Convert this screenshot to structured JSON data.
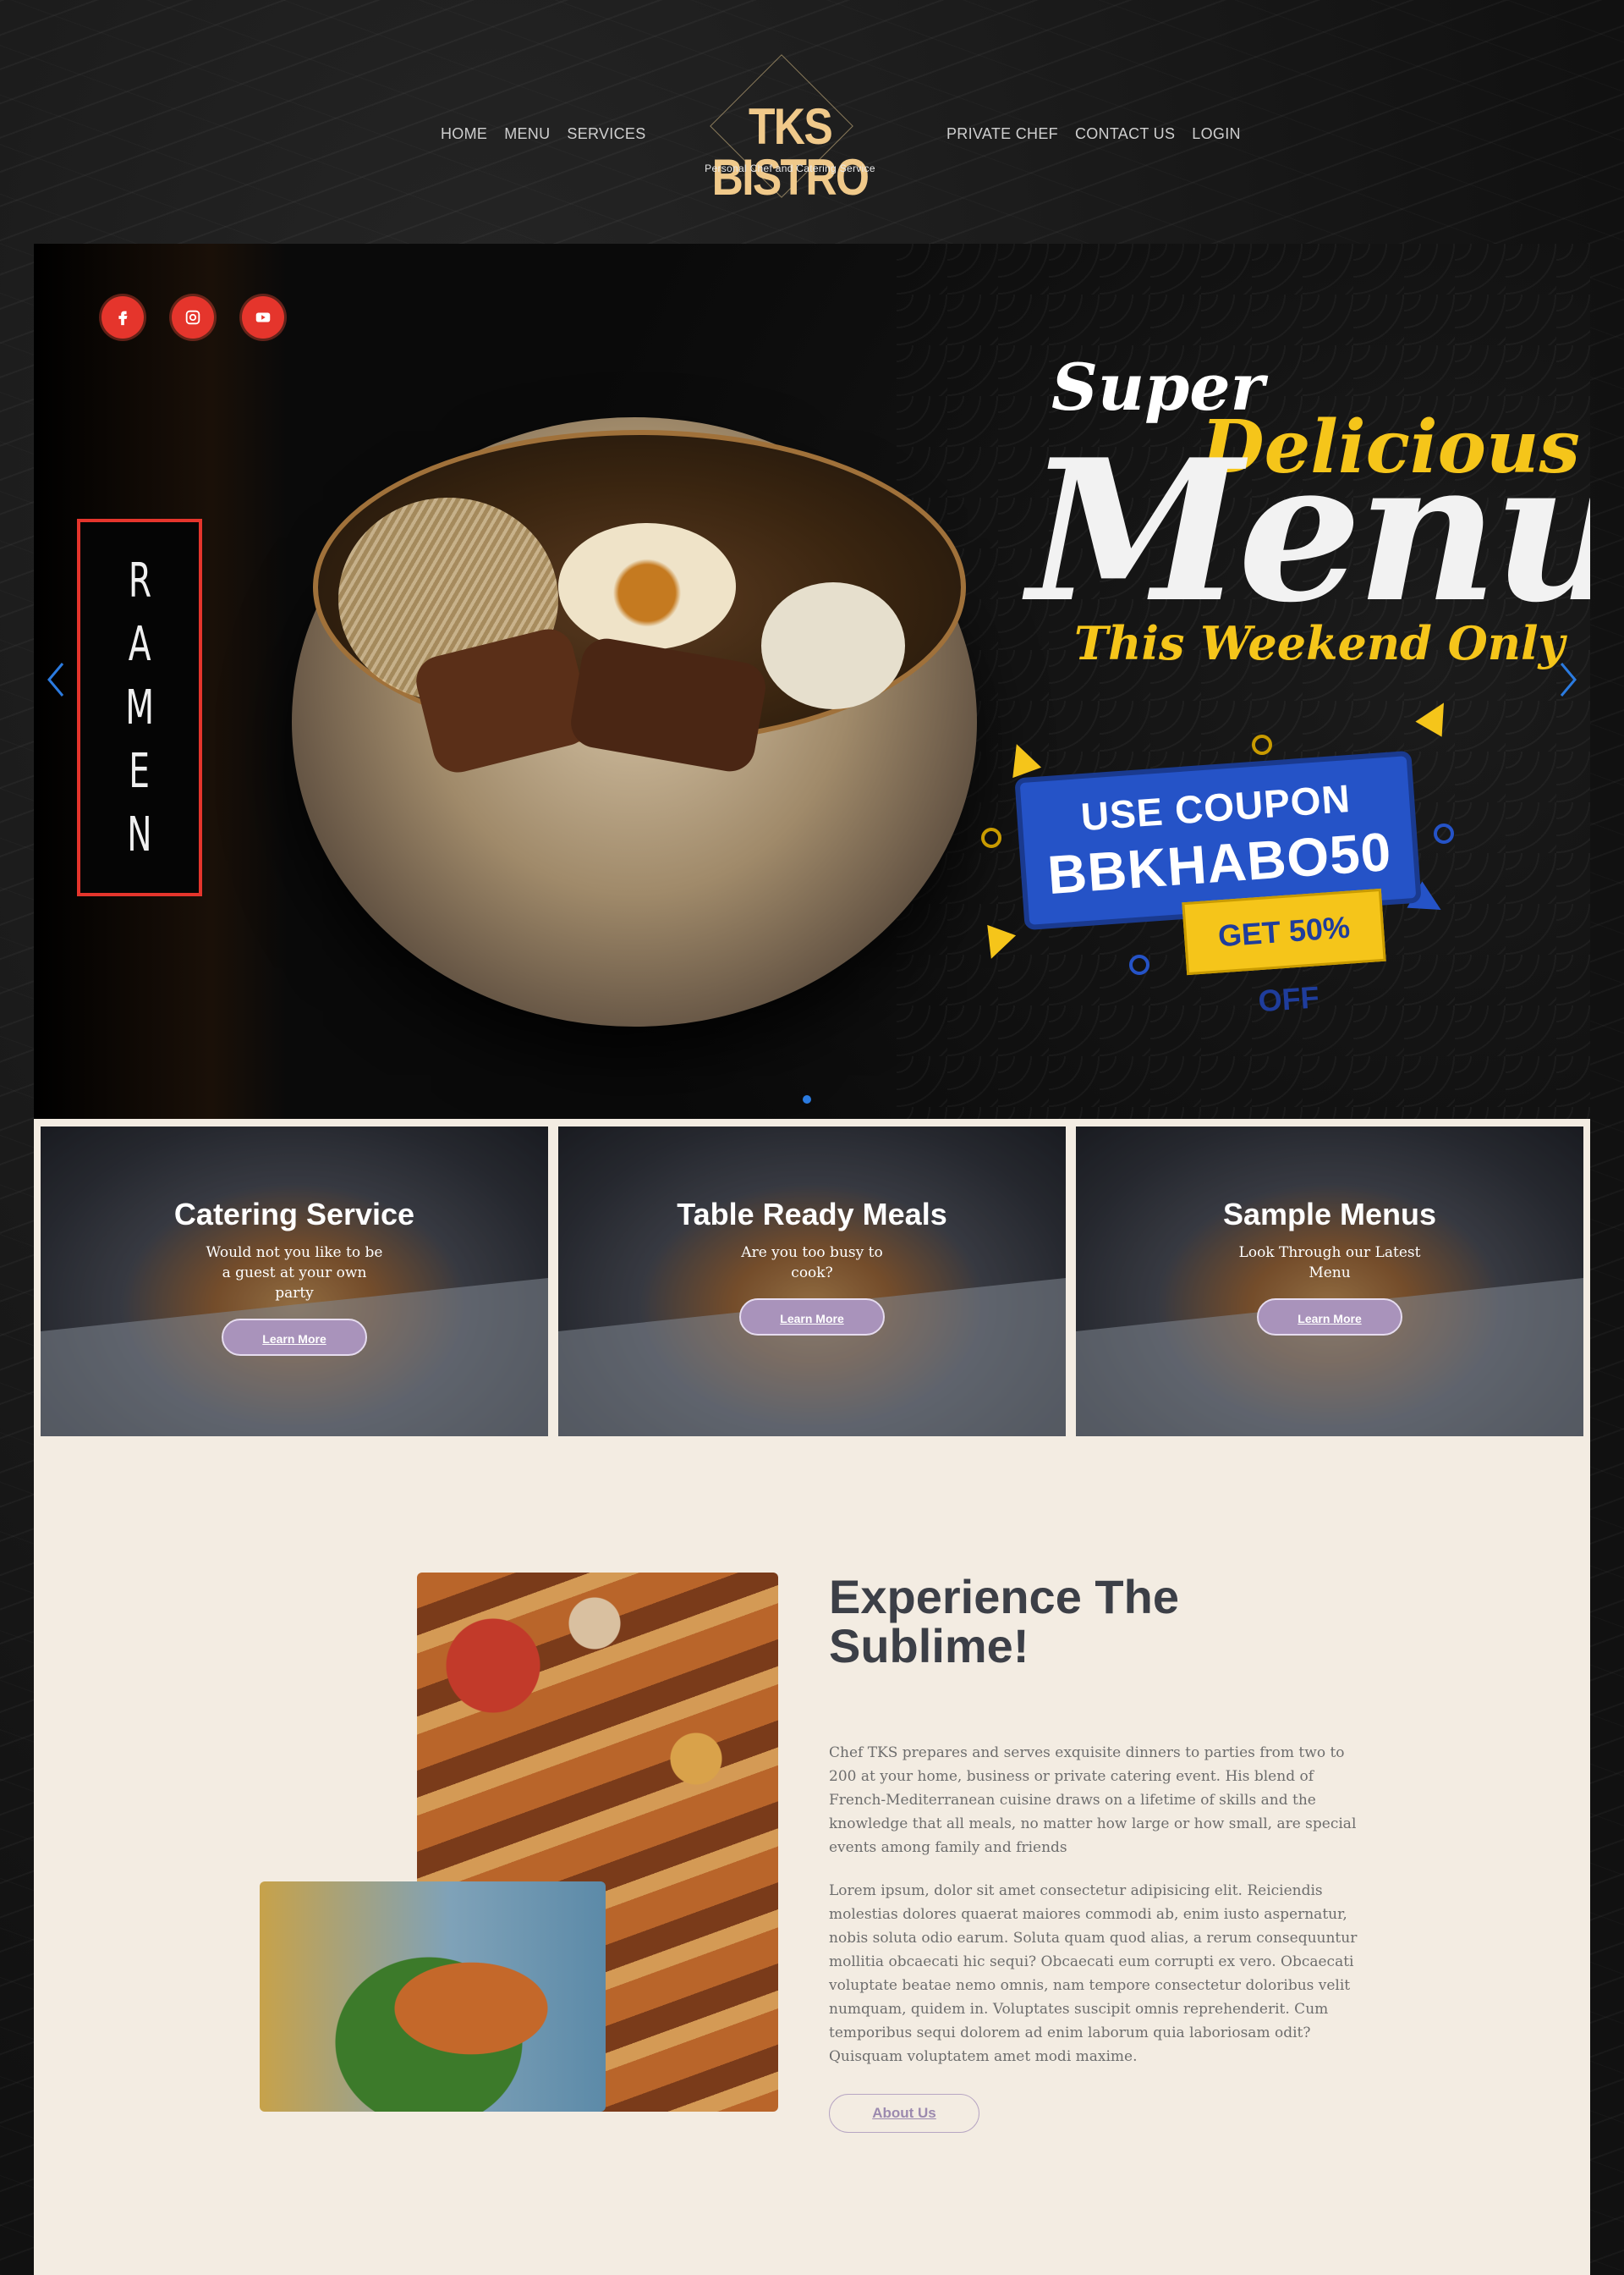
{
  "brand": {
    "name": "TKS BISTRO",
    "tagline": "Personal Chef and Catering Service"
  },
  "nav": {
    "left": [
      "HOME",
      "MENU",
      "SERVICES"
    ],
    "right": [
      "PRIVATE CHEF",
      "CONTACT US",
      "LOGIN"
    ]
  },
  "hero": {
    "social_icons": [
      "facebook-icon",
      "instagram-icon",
      "youtube-icon"
    ],
    "vertical_label": [
      "R",
      "A",
      "M",
      "E",
      "N"
    ],
    "promo": {
      "super": "Super",
      "delicious": "Delicious",
      "menu": "Menu",
      "weekend": "This Weekend Only",
      "coupon_line1": "USE COUPON",
      "coupon_code": "BBKHABO50",
      "discount": "GET 50% OFF"
    },
    "prev_arrow": "chevron-left-icon",
    "next_arrow": "chevron-right-icon"
  },
  "cards": [
    {
      "title": "Catering Service",
      "subtitle": "Would not you like to be a guest at your own party",
      "button": "Learn More"
    },
    {
      "title": "Table Ready Meals",
      "subtitle": "Are you too busy to cook?",
      "button": "Learn More"
    },
    {
      "title": "Sample Menus",
      "subtitle": "Look Through our Latest Menu",
      "button": "Learn More"
    }
  ],
  "about": {
    "title": "Experience The Sublime!",
    "paragraph1": "Chef TKS prepares and serves exquisite dinners to parties from two to 200 at your home, business or private catering event. His blend of French-Mediterranean cuisine draws on a lifetime of skills and the knowledge that all meals, no matter how large or how small, are special events among family and friends",
    "paragraph2": "Lorem ipsum, dolor sit amet consectetur adipisicing elit. Reiciendis molestias dolores quaerat maiores commodi ab, enim iusto aspernatur, nobis soluta odio earum. Soluta quam quod alias, a rerum consequuntur mollitia obcaecati hic sequi? Obcaecati eum corrupti ex vero. Obcaecati voluptate beatae nemo omnis, nam tempore consectetur doloribus velit numquam, quidem in. Voluptates suscipit omnis reprehenderit. Cum temporibus sequi dolorem ad enim laborum quia laboriosam odit? Quisquam voluptatem amet modi maxime.",
    "button": "About Us"
  },
  "colors": {
    "accent_gold": "#f0c98a",
    "social_red": "#e5352c",
    "button_purple": "#a993bb",
    "cream": "#f3ece2",
    "heading": "#3c3f47"
  }
}
